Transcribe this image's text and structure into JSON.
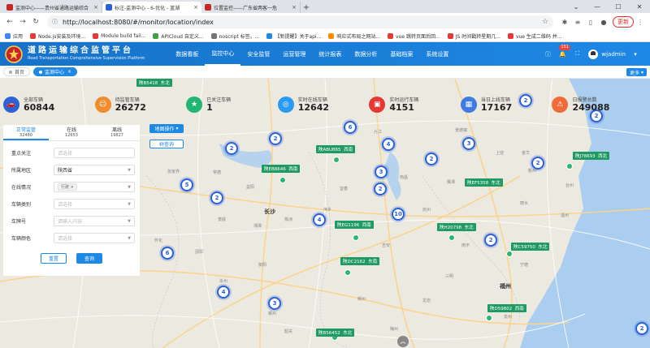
{
  "browser": {
    "tabs": [
      {
        "title": "监测中心——贵州省通路运输综合",
        "active": false
      },
      {
        "title": "标注-监测中心 - 6-优化 - 蓝湖",
        "active": true
      },
      {
        "title": "位置监控——广东省两客一危",
        "active": false
      }
    ],
    "new_tab": "+",
    "url": "http://localhost:8080/#/monitor/location/index",
    "update_label": "更新",
    "bookmarks": [
      "应用",
      "Node.js安装及环境...",
      "Module build fail...",
      "APICloud 自定义...",
      "noscript 标签。...",
      "【新提醒】关于api...",
      "响应式布局之网站...",
      "vue 跳转页面后回...",
      "JS 时间戳转星期几...",
      "vue 生成二维码 并..."
    ]
  },
  "header": {
    "title_cn": "道路运输综合监管平台",
    "title_en": "Road Transportation Comprehensive Supervision Platform",
    "menu": [
      {
        "label": "数据看板",
        "active": false
      },
      {
        "label": "监控中心",
        "active": true
      },
      {
        "label": "安全监管",
        "active": false
      },
      {
        "label": "运营管理",
        "active": false
      },
      {
        "label": "统计报表",
        "active": false
      },
      {
        "label": "数据分析",
        "active": false
      },
      {
        "label": "基础档案",
        "active": false
      },
      {
        "label": "系统设置",
        "active": false
      }
    ],
    "notification_count": "151",
    "username": "wjadmin"
  },
  "crumbs": [
    {
      "label": "首页",
      "active": false
    },
    {
      "label": "监测中心",
      "active": true
    }
  ],
  "more_label": "更多",
  "stats": [
    {
      "label": "全部车辆",
      "value": "60844",
      "color": "#2b62d8",
      "icon": "car-icon"
    },
    {
      "label": "待监管车辆",
      "value": "26272",
      "color": "#f08c2e",
      "icon": "user-icon"
    },
    {
      "label": "已关注车辆",
      "value": "1",
      "color": "#22b573",
      "icon": "star-icon"
    },
    {
      "label": "实时在线车辆",
      "value": "12642",
      "color": "#2b9af3",
      "icon": "signal-icon"
    },
    {
      "label": "实时运行车辆",
      "value": "4151",
      "color": "#e53935",
      "icon": "truck-icon"
    },
    {
      "label": "当日上线车辆",
      "value": "17167",
      "color": "#3f7be0",
      "icon": "calendar-icon"
    },
    {
      "label": "日报警总数",
      "value": "249088",
      "color": "#ef6c3a",
      "icon": "alarm-icon"
    }
  ],
  "panel": {
    "tabs": [
      {
        "label": "正常监管",
        "count": "32480",
        "active": true
      },
      {
        "label": "在线",
        "count": "12653",
        "active": false
      },
      {
        "label": "离线",
        "count": "19827",
        "active": false
      }
    ],
    "filters": [
      {
        "label": "重点关注",
        "value": "",
        "placeholder": "请选择",
        "dropdown": false
      },
      {
        "label": "所属地区",
        "value": "陕西省",
        "placeholder": "",
        "dropdown": true
      },
      {
        "label": "在线情况",
        "value": "行驶",
        "placeholder": "",
        "dropdown": true,
        "chip": true
      },
      {
        "label": "车辆类别",
        "value": "",
        "placeholder": "请选择",
        "dropdown": true
      },
      {
        "label": "车牌号",
        "value": "",
        "placeholder": "请输入内容",
        "dropdown": true
      },
      {
        "label": "车辆颜色",
        "value": "",
        "placeholder": "请选择",
        "dropdown": true
      }
    ],
    "reset_label": "重置",
    "query_label": "查询"
  },
  "map_buttons": {
    "map_ops": "地图操作",
    "tree_query": "树查询"
  },
  "clusters": [
    "2",
    "2",
    "6",
    "2",
    "4",
    "2",
    "3",
    "2",
    "5",
    "2",
    "3",
    "4",
    "10",
    "2",
    "2",
    "6",
    "4",
    "3",
    "2",
    "2"
  ],
  "vehicles": [
    {
      "plate": "陕ABU865",
      "dir": "西南"
    },
    {
      "plate": "陕EB8646",
      "dir": "西南"
    },
    {
      "plate": "陕EF5358",
      "dir": "东北"
    },
    {
      "plate": "陕J78693",
      "dir": "西北"
    },
    {
      "plate": "陕EG1196",
      "dir": "西南"
    },
    {
      "plate": "陕H20798",
      "dir": "东北"
    },
    {
      "plate": "陕C59750",
      "dir": "东北"
    },
    {
      "plate": "陕DC2162",
      "dir": "东南"
    },
    {
      "plate": "陕D59802",
      "dir": "西南"
    },
    {
      "plate": "陕B56452",
      "dir": "东北"
    },
    {
      "plate": "陕B5418",
      "dir": "东北"
    }
  ],
  "cities": [
    "长沙",
    "福州"
  ],
  "towns": [
    "张家界",
    "常德",
    "益阳",
    "岳阳",
    "九江",
    "景德镇",
    "南昌",
    "宜春",
    "萍乡",
    "株洲",
    "湘潭",
    "娄底",
    "邵阳",
    "衡阳",
    "郴州",
    "赣州",
    "吉安",
    "抚州",
    "鹰潭",
    "上饶",
    "衢州",
    "金华",
    "丽水",
    "南平",
    "三明",
    "龙岩",
    "宁德",
    "温州",
    "台州",
    "怀化",
    "永州",
    "韶关",
    "梅州",
    "泉州"
  ]
}
